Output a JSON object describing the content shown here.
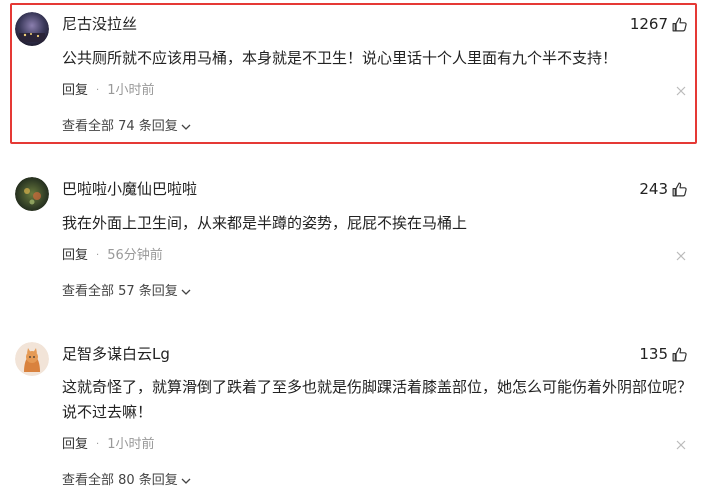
{
  "comments": [
    {
      "username": "尼古没拉丝",
      "likes": "1267",
      "text": "公共厕所就不应该用马桶，本身就是不卫生！说心里话十个人里面有九个半不支持！",
      "reply_label": "回复",
      "separator": "·",
      "time": "1小时前",
      "view_all": "查看全部 74 条回复"
    },
    {
      "username": "巴啦啦小魔仙巴啦啦",
      "likes": "243",
      "text": "我在外面上卫生间，从来都是半蹲的姿势，屁屁不挨在马桶上",
      "reply_label": "回复",
      "separator": "·",
      "time": "56分钟前",
      "view_all": "查看全部 57 条回复"
    },
    {
      "username": "足智多谋白云Lg",
      "likes": "135",
      "text": "这就奇怪了，就算滑倒了跌着了至多也就是伤脚踝活着膝盖部位，她怎么可能伤着外阴部位呢？说不过去嘛！",
      "reply_label": "回复",
      "separator": "·",
      "time": "1小时前",
      "view_all": "查看全部 80 条回复"
    }
  ],
  "icons": {
    "like": "thumbs-up-icon",
    "close": "close-icon",
    "expand": "chevron-down-icon"
  },
  "colors": {
    "highlight": "#e53935",
    "muted": "#999999"
  }
}
